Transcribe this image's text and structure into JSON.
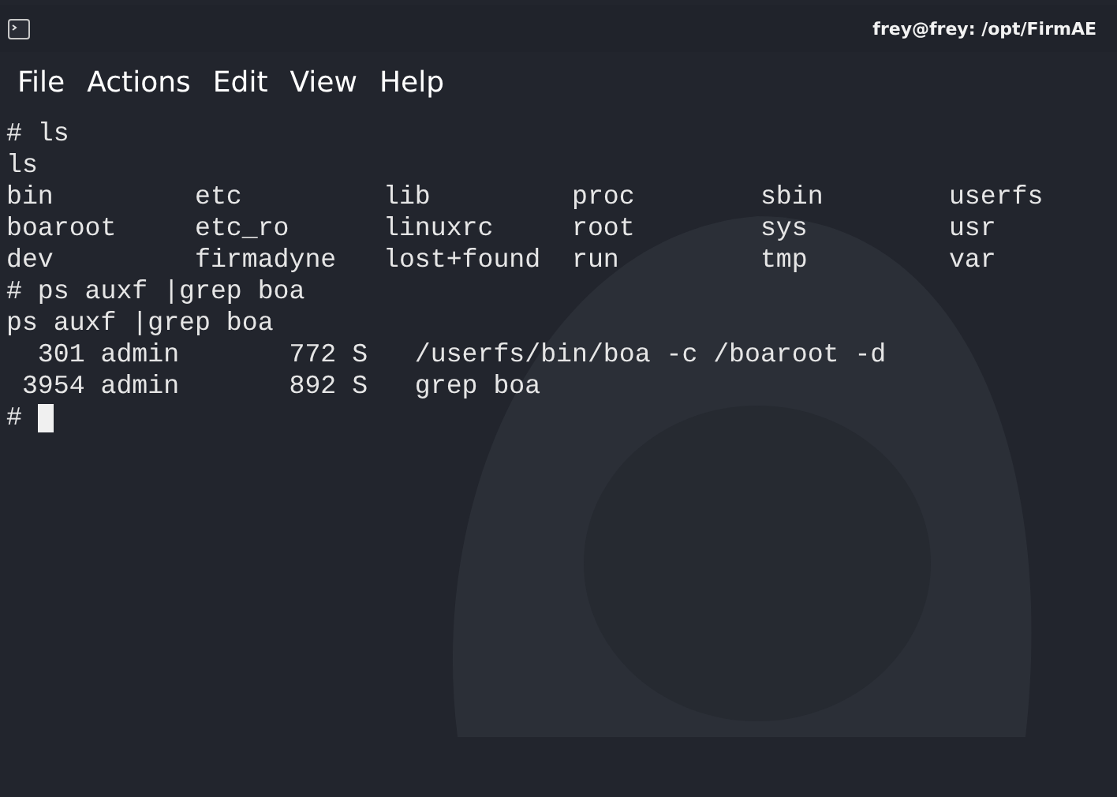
{
  "window": {
    "title": "frey@frey: /opt/FirmAE"
  },
  "menu": [
    "File",
    "Actions",
    "Edit",
    "View",
    "Help"
  ],
  "terminal": {
    "lines": [
      "# ls",
      "ls",
      "bin         etc         lib         proc        sbin        userfs",
      "boaroot     etc_ro      linuxrc     root        sys         usr",
      "dev         firmadyne   lost+found  run         tmp         var",
      "# ps auxf |grep boa",
      "ps auxf |grep boa",
      "  301 admin       772 S   /userfs/bin/boa -c /boaroot -d",
      " 3954 admin       892 S   grep boa"
    ],
    "prompt": "#",
    "cursor": true
  }
}
